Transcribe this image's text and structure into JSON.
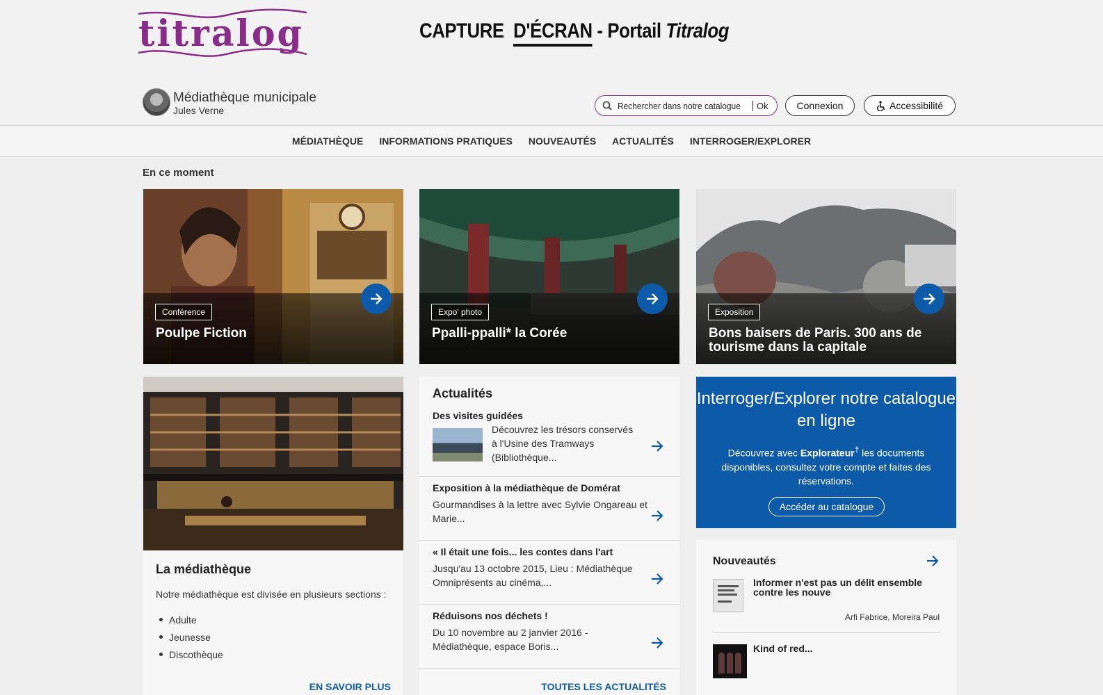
{
  "header": {
    "logo_text": "titralog",
    "caption": {
      "part1": "CAPTURE",
      "part2": "D'ÉCRAN",
      "part3": "- Portail",
      "part4": "Titralog"
    },
    "site_name": "Médiathèque municipale",
    "site_subtitle": "Jules Verne",
    "search": {
      "placeholder": "Rechercher dans notre catalogue",
      "submit": "Ok"
    },
    "login": "Connexion",
    "accessibility": "Accessibilité"
  },
  "nav": [
    "MÉDIATHÈQUE",
    "INFORMATIONS PRATIQUES",
    "NOUVEAUTÉS",
    "ACTUALITÉS",
    "INTERROGER/EXPLORER"
  ],
  "section_title": "En ce moment",
  "cards": [
    {
      "tag": "Conférence",
      "title": "Poulpe Fiction"
    },
    {
      "tag": "Expo' photo",
      "title": "Ppalli-ppalli* la Corée"
    },
    {
      "tag": "Exposition",
      "title": "Bons baisers de Paris. 300 ans de tourisme dans la capitale"
    }
  ],
  "mediatheque": {
    "title": "La médiathèque",
    "intro": "Notre médiathèque est divisée en plusieurs sections :",
    "sections": [
      "Adulte",
      "Jeunesse",
      "Discothèque"
    ],
    "more": "EN SAVOIR PLUS"
  },
  "news": {
    "title": "Actualités",
    "items": [
      {
        "title": "Des visites guidées",
        "desc": "Découvrez les trésors conservés à l'Usine des Tramways (Bibliothèque..."
      },
      {
        "title": "Exposition à la médiathèque de Domérat",
        "desc": "Gourmandises à la lettre avec Sylvie Ongareau et Marie..."
      },
      {
        "title": "« Il était une fois... les contes dans l'art",
        "desc": "Jusqu'au 13 octobre 2015, Lieu : Médiathèque Omniprésents au cinéma,..."
      },
      {
        "title": "Réduisons nos déchets !",
        "desc": "Du 10 novembre au 2 janvier 2016 - Médiathèque, espace Boris..."
      }
    ],
    "all": "TOUTES LES ACTUALITÉS"
  },
  "explore": {
    "title": "Interroger/Explorer notre catalogue en ligne",
    "text_before": "Découvrez avec ",
    "brand": "Explorateur",
    "sup": "†",
    "text_after": " les documents disponibles, consultez votre compte et faites des réservations.",
    "button": "Accéder au catalogue"
  },
  "novelties": {
    "title": "Nouveautés",
    "items": [
      {
        "title": "Informer n'est pas un délit ensemble contre les nouve",
        "authors": "Arfi Fabrice, Moreira Paul"
      },
      {
        "title": "Kind of red..."
      }
    ]
  },
  "colors": {
    "accent": "#0d5aa8",
    "logo": "#8a2d8a",
    "background": "#efefef"
  }
}
